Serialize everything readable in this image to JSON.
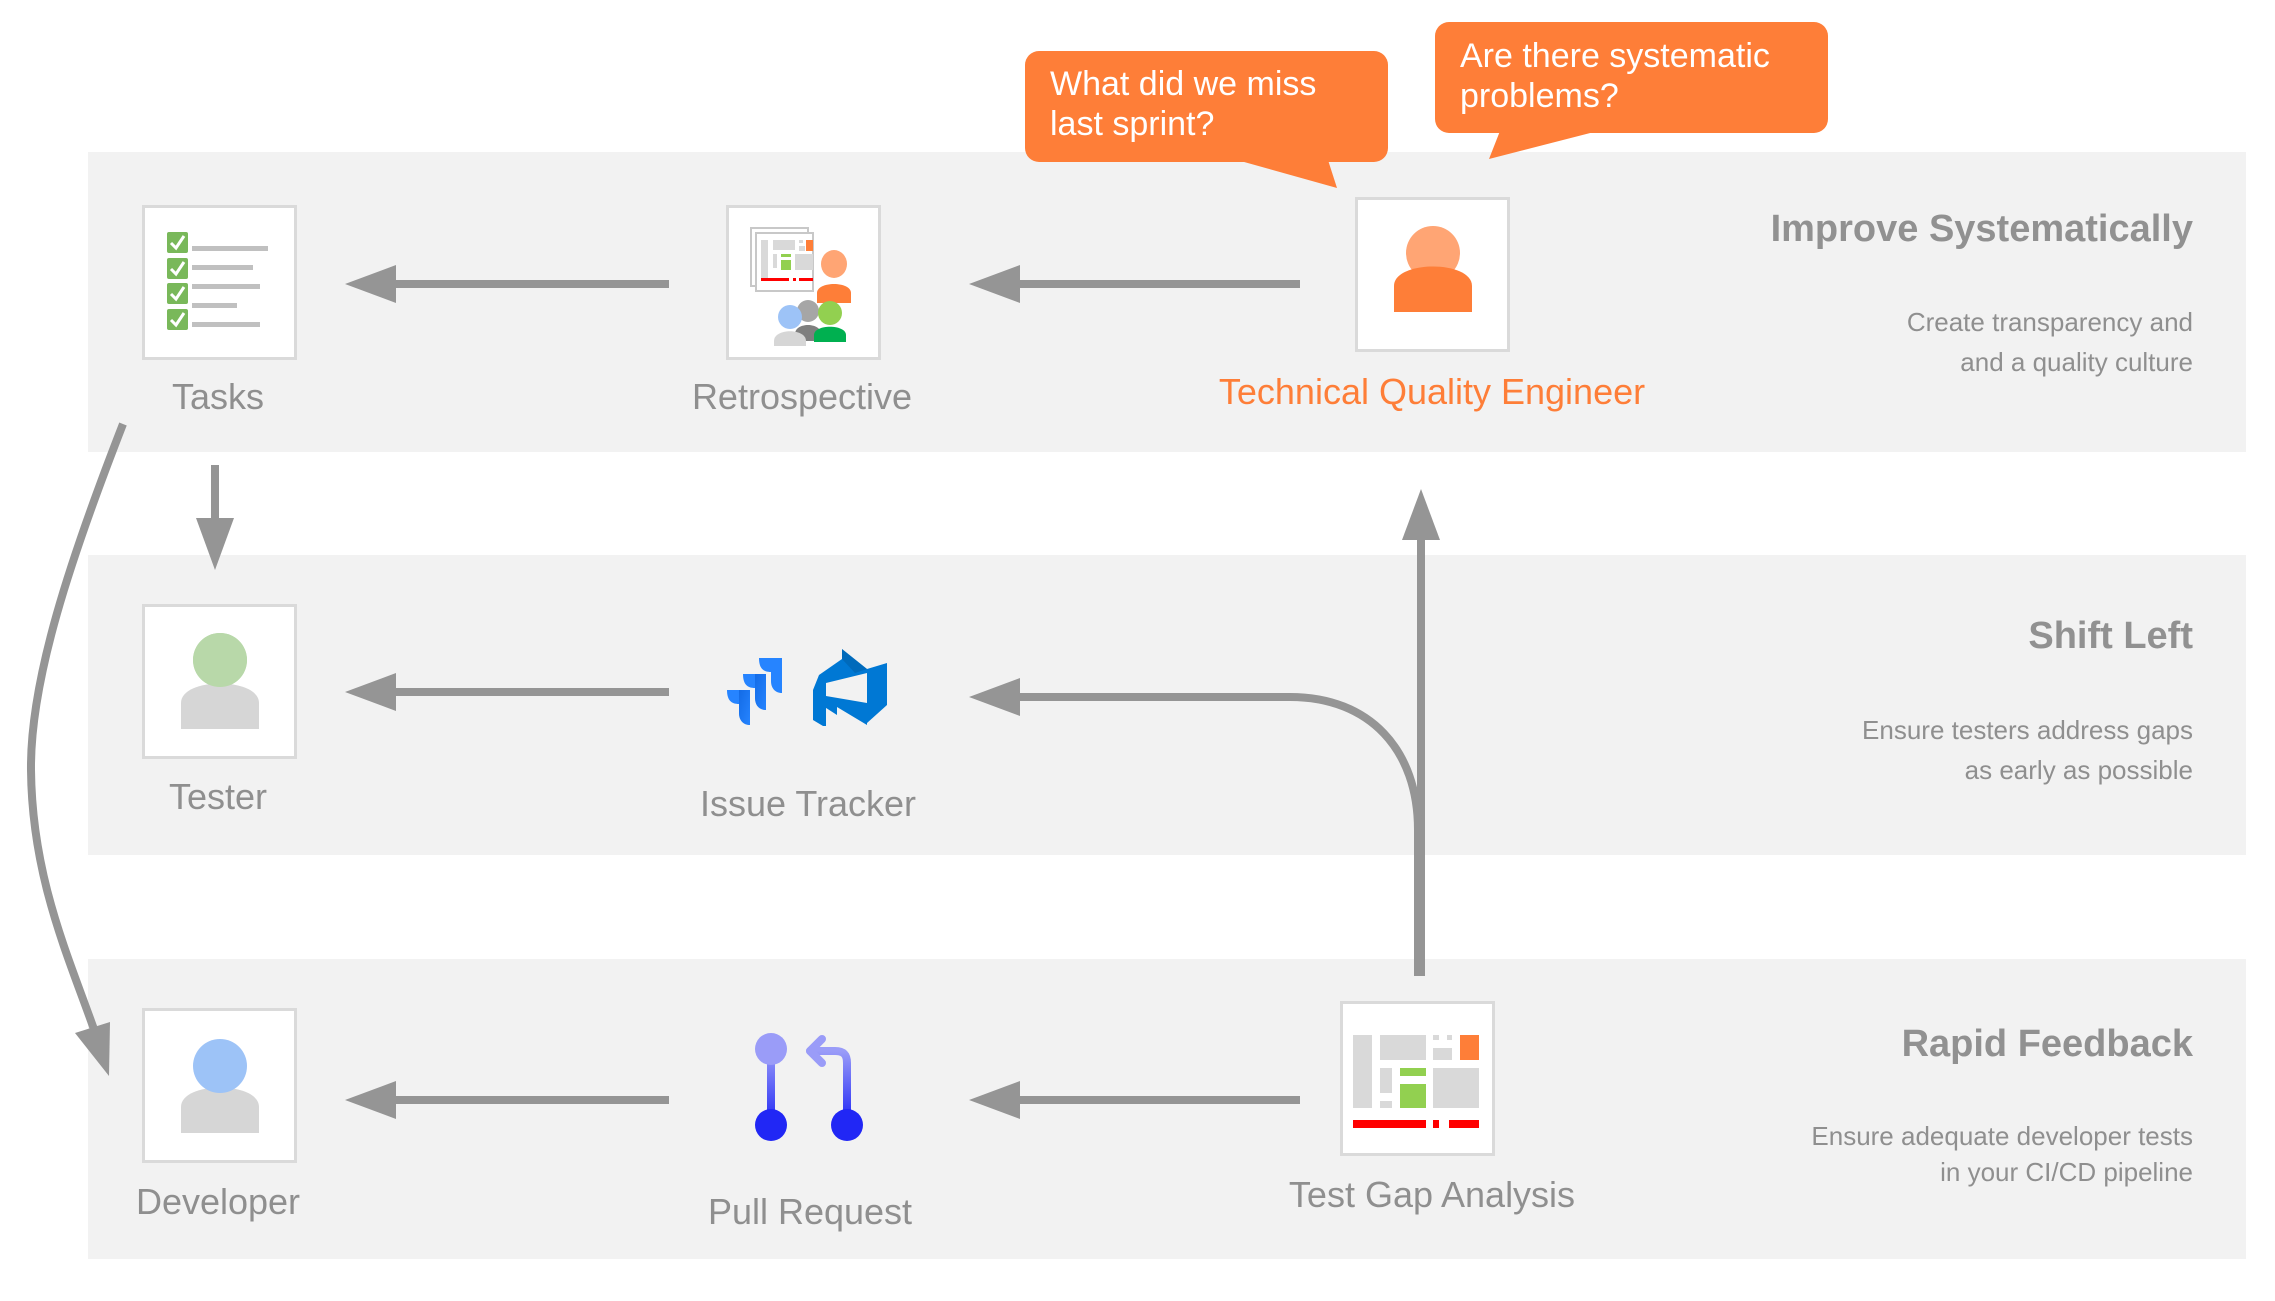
{
  "colors": {
    "band": "#f2f2f2",
    "arrow": "#959595",
    "accent": "#fe7e38",
    "label": "#8f8f8f",
    "box_border": "#dadada"
  },
  "bands": [
    {
      "id": "improve",
      "title": "Improve Systematically",
      "description": [
        "Create transparency and",
        "and a quality culture"
      ]
    },
    {
      "id": "shift-left",
      "title": "Shift Left",
      "description": [
        "Ensure testers address gaps",
        "as early as possible"
      ]
    },
    {
      "id": "rapid-feedback",
      "title": "Rapid Feedback",
      "description": [
        "Ensure adequate developer tests",
        "in your CI/CD pipeline"
      ]
    }
  ],
  "nodes": {
    "tasks": {
      "label": "Tasks",
      "icon": "checklist-icon"
    },
    "retrospective": {
      "label": "Retrospective",
      "icon": "retrospective-meeting-icon"
    },
    "tqe": {
      "label": "Technical Quality Engineer",
      "icon": "person-icon",
      "highlight": true
    },
    "tester": {
      "label": "Tester",
      "icon": "person-icon"
    },
    "issue_tracker": {
      "label": "Issue Tracker",
      "icons": [
        "jira-icon",
        "azure-devops-icon"
      ]
    },
    "developer": {
      "label": "Developer",
      "icon": "person-icon"
    },
    "pull_request": {
      "label": "Pull Request",
      "icon": "pull-request-icon"
    },
    "test_gap": {
      "label": "Test Gap Analysis",
      "icon": "treemap-icon"
    }
  },
  "bubbles": [
    {
      "lines": [
        "What did we miss",
        "last sprint?"
      ]
    },
    {
      "lines": [
        "Are there systematic",
        "problems?"
      ]
    }
  ],
  "edges": [
    {
      "from": "tqe",
      "to": "retrospective"
    },
    {
      "from": "retrospective",
      "to": "tasks"
    },
    {
      "from": "tasks",
      "to": "tester"
    },
    {
      "from": "tasks",
      "to": "developer"
    },
    {
      "from": "issue_tracker",
      "to": "tester"
    },
    {
      "from": "test_gap",
      "to": "issue_tracker"
    },
    {
      "from": "test_gap",
      "to": "tqe"
    },
    {
      "from": "pull_request",
      "to": "developer"
    },
    {
      "from": "test_gap",
      "to": "pull_request"
    }
  ]
}
